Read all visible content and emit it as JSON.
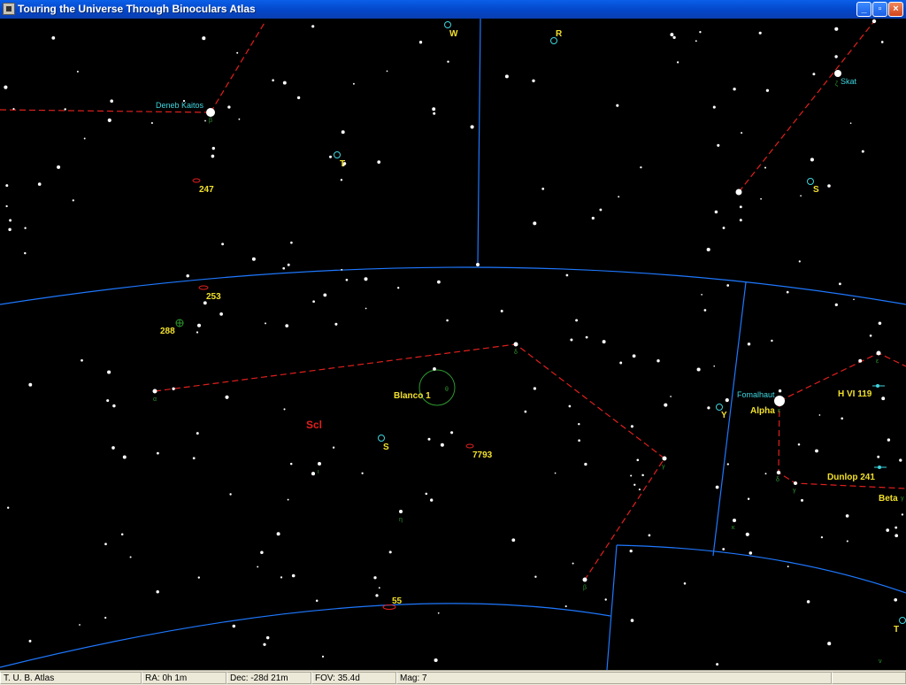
{
  "window": {
    "title": "Touring the Universe Through Binoculars Atlas"
  },
  "colors": {
    "background": "#000000",
    "star": "#ffffff",
    "constellation_line": "#e0201e",
    "boundary": "#1e78ff",
    "star_name": "#3fd6e0",
    "object_label": "#f2e02a",
    "constellation_abbrev": "#e0201e",
    "greek_letter": "#2f9a2f"
  },
  "map": {
    "star_names": [
      "Deneb Kaitos",
      "Skat",
      "Fomalhaut"
    ],
    "variable_labels": [
      "W",
      "R",
      "T",
      "S",
      "S",
      "Y",
      "T"
    ],
    "object_labels": [
      "247",
      "253",
      "288",
      "Blanco 1",
      "7793",
      "55",
      "Alpha",
      "H VI 119",
      "Dunlop 241",
      "Beta"
    ],
    "constellation": "Scl",
    "greek_letters": [
      "β",
      "α",
      "δ",
      "γ",
      "ι",
      "η",
      "θ",
      "β",
      "ε",
      "δ",
      "γ",
      "ζ",
      "ε",
      "γ",
      "κ",
      "ν"
    ]
  },
  "status": {
    "app": "T. U. B. Atlas",
    "ra": "RA: 0h 1m",
    "dec": "Dec: -28d 21m",
    "fov": "FOV: 35.4d",
    "mag": "Mag: 7"
  }
}
